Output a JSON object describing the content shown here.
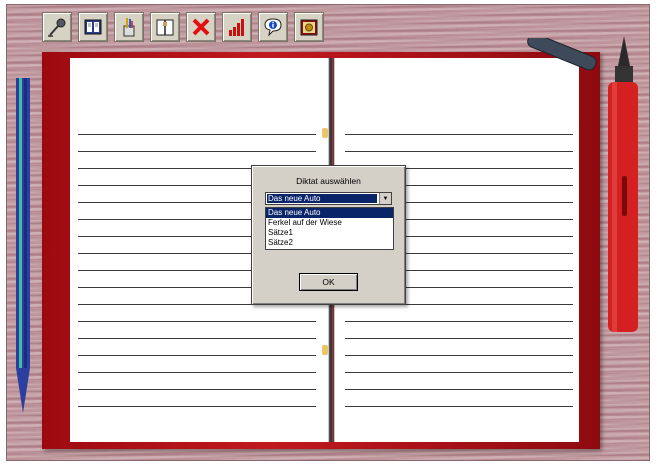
{
  "toolbar": {
    "buttons": [
      {
        "icon": "microphone-icon"
      },
      {
        "icon": "book-icon"
      },
      {
        "icon": "pencil-cup-icon"
      },
      {
        "icon": "open-book-icon"
      },
      {
        "icon": "close-x-icon"
      },
      {
        "icon": "bar-chart-icon"
      },
      {
        "icon": "info-icon"
      },
      {
        "icon": "camera-icon"
      }
    ]
  },
  "dialog": {
    "title": "Diktat auswählen",
    "combo_value": "Das neue Auto",
    "options": [
      "Das neue Auto",
      "Ferkel auf der Wiese",
      "Sätze1",
      "Sätze2"
    ],
    "selected_index": 0,
    "ok_label": "OK"
  },
  "colors": {
    "cover": "#b0141a",
    "selection": "#0a246a",
    "dialog_bg": "#d4d0c8"
  }
}
